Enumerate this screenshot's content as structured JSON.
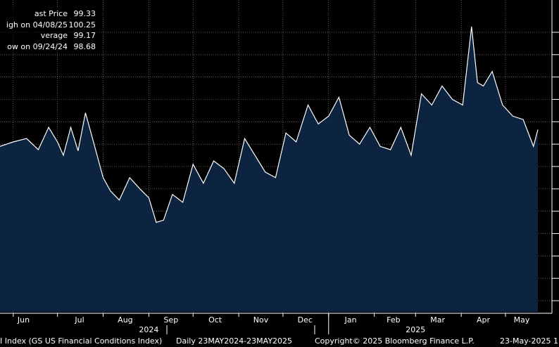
{
  "chart_data": {
    "type": "area",
    "x_tick_labels": [
      "Jun",
      "Jul",
      "Aug",
      "Sep",
      "Oct",
      "Nov",
      "Dec",
      "Jan",
      "Feb",
      "Mar",
      "Apr",
      "May"
    ],
    "year_labels": [
      "2024",
      "2025"
    ],
    "x_range": [
      "2024-05-23",
      "2025-05-23"
    ],
    "ylim": [
      97.7,
      100.25
    ],
    "grid": true,
    "colors": {
      "fill": "#0d2440",
      "line": "#ffffff",
      "grid": "#9a9a9a",
      "background": "#000000"
    },
    "series": [
      {
        "x": [
          "2024-05-23",
          "2024-06-01",
          "2024-06-10",
          "2024-06-18",
          "2024-06-25",
          "2024-07-01",
          "2024-07-05",
          "2024-07-10",
          "2024-07-15",
          "2024-07-20",
          "2024-07-25",
          "2024-08-01",
          "2024-08-06",
          "2024-08-12",
          "2024-08-19",
          "2024-08-26",
          "2024-09-01",
          "2024-09-06",
          "2024-09-11",
          "2024-09-17",
          "2024-09-24",
          "2024-10-01",
          "2024-10-08",
          "2024-10-15",
          "2024-10-22",
          "2024-10-29",
          "2024-11-05",
          "2024-11-12",
          "2024-11-19",
          "2024-11-26",
          "2024-12-03",
          "2024-12-10",
          "2024-12-18",
          "2024-12-25",
          "2025-01-01",
          "2025-01-08",
          "2025-01-15",
          "2025-01-22",
          "2025-01-29",
          "2025-02-05",
          "2025-02-12",
          "2025-02-19",
          "2025-02-26",
          "2025-03-05",
          "2025-03-12",
          "2025-03-19",
          "2025-03-26",
          "2025-04-02",
          "2025-04-08",
          "2025-04-12",
          "2025-04-16",
          "2025-04-22",
          "2025-04-29",
          "2025-05-06",
          "2025-05-13",
          "2025-05-20",
          "2025-05-23"
        ],
        "y": [
          99.18,
          99.22,
          99.25,
          99.15,
          99.35,
          99.22,
          99.1,
          99.35,
          99.14,
          99.48,
          99.24,
          98.9,
          98.78,
          98.7,
          98.9,
          98.8,
          98.72,
          98.5,
          98.52,
          98.75,
          98.68,
          99.02,
          98.85,
          99.05,
          98.98,
          98.85,
          99.25,
          99.1,
          98.95,
          98.9,
          99.3,
          99.22,
          99.55,
          99.38,
          99.45,
          99.62,
          99.28,
          99.2,
          99.35,
          99.18,
          99.15,
          99.35,
          99.1,
          99.65,
          99.55,
          99.72,
          99.6,
          99.55,
          100.25,
          99.75,
          99.72,
          99.85,
          99.55,
          99.45,
          99.42,
          99.18,
          99.33
        ]
      }
    ]
  },
  "legend": [
    {
      "label": "ast Price",
      "value": "99.33"
    },
    {
      "label": "igh on 04/08/25",
      "value": "100.25"
    },
    {
      "label": "verage",
      "value": "99.17"
    },
    {
      "label": "ow on 09/24/24",
      "value": "98.68"
    }
  ],
  "footer": {
    "index_label": "I Index (GS US Financial Conditions Index)",
    "range_label": "Daily 23MAY2024-23MAY2025",
    "copyright": "Copyright© 2025 Bloomberg Finance L.P.",
    "date_label": "23-May-2025 1"
  }
}
